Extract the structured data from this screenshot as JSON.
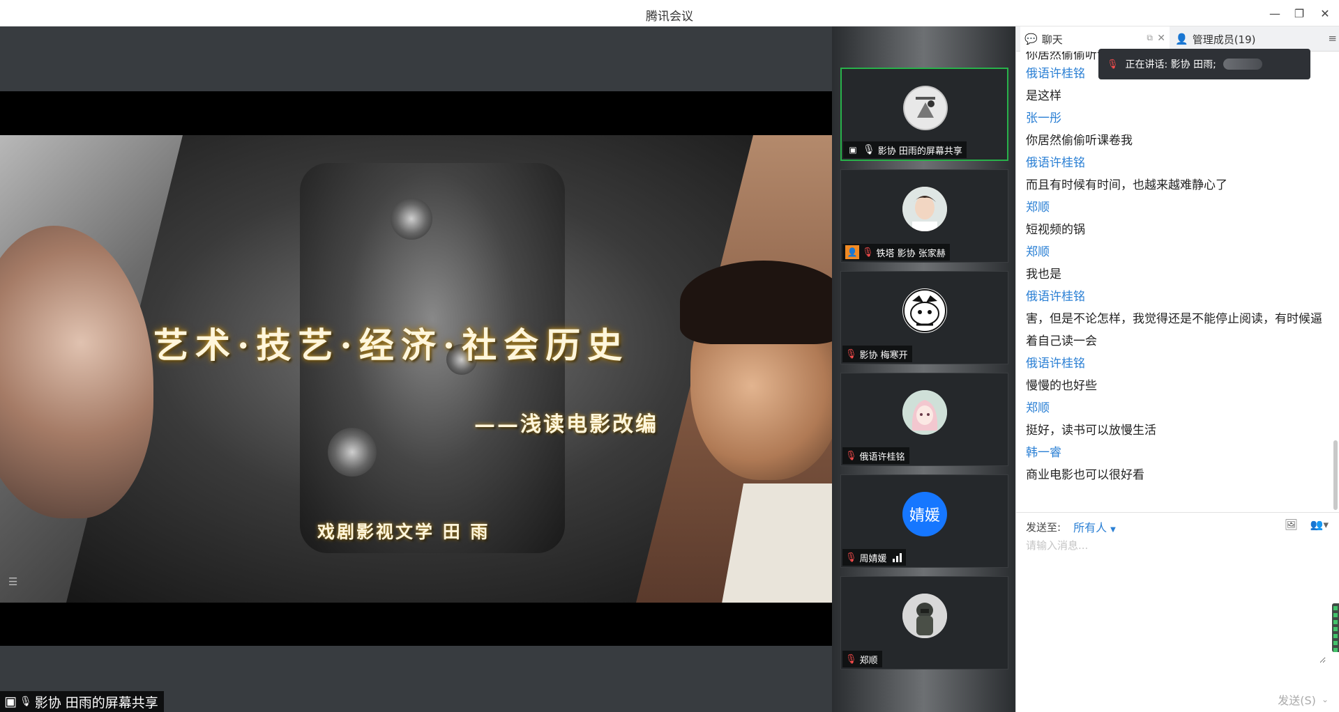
{
  "window": {
    "title": "腾讯会议",
    "minimize": "—",
    "restore": "❐",
    "close": "✕"
  },
  "slide": {
    "title": "艺术·技艺·经济·社会历史",
    "subtitle": "——浅读电影改编",
    "author": "戏剧影视文学 田 雨"
  },
  "share_label": "影协 田雨的屏幕共享",
  "participants": [
    {
      "name": "影协 田雨的屏幕共享",
      "mic": "on",
      "active": true,
      "avatar": "poster"
    },
    {
      "name": "铁塔 影协 张家赫",
      "mic": "muted",
      "active": false,
      "avatar": "photo",
      "badge": "person-icon"
    },
    {
      "name": "影协 梅寒开",
      "mic": "muted",
      "active": false,
      "avatar": "cartoon"
    },
    {
      "name": "俄语许桂铭",
      "mic": "muted",
      "active": false,
      "avatar": "anime"
    },
    {
      "name": "周婧媛",
      "mic": "muted",
      "active": false,
      "avatar": "initials",
      "initials": "婧媛",
      "avatar_color": "#1677ff",
      "signal": "signal-bars-icon"
    },
    {
      "name": "郑顺",
      "mic": "muted",
      "active": false,
      "avatar": "soldier"
    }
  ],
  "panel": {
    "tab_chat": "聊天",
    "tab_members": "管理成员(19)",
    "speaking": "正在讲话: 影协 田雨;"
  },
  "messages": [
    {
      "type": "text",
      "text": "你居然偷偷听课卷我",
      "partial": true
    },
    {
      "type": "sender",
      "text": "俄语许桂铭"
    },
    {
      "type": "text",
      "text": "是这样"
    },
    {
      "type": "sender",
      "text": "张一彤"
    },
    {
      "type": "text",
      "text": "你居然偷偷听课卷我"
    },
    {
      "type": "sender",
      "text": "俄语许桂铭"
    },
    {
      "type": "text",
      "text": "而且有时候有时间，也越来越难静心了"
    },
    {
      "type": "sender",
      "text": "郑顺"
    },
    {
      "type": "text",
      "text": "短视频的锅"
    },
    {
      "type": "sender",
      "text": "郑顺"
    },
    {
      "type": "text",
      "text": "我也是"
    },
    {
      "type": "sender",
      "text": "俄语许桂铭"
    },
    {
      "type": "text",
      "text": "害，但是不论怎样，我觉得还是不能停止阅读，有时候逼着自己读一会",
      "wrap": true
    },
    {
      "type": "sender",
      "text": "俄语许桂铭"
    },
    {
      "type": "text",
      "text": "慢慢的也好些"
    },
    {
      "type": "sender",
      "text": "郑顺"
    },
    {
      "type": "text",
      "text": "挺好，读书可以放慢生活"
    },
    {
      "type": "sender",
      "text": "韩一睿"
    },
    {
      "type": "text",
      "text": "商业电影也可以很好看"
    }
  ],
  "compose": {
    "send_to_label": "发送至:",
    "send_to_target": "所有人",
    "placeholder": "请输入消息...",
    "send_button": "发送(S)"
  }
}
